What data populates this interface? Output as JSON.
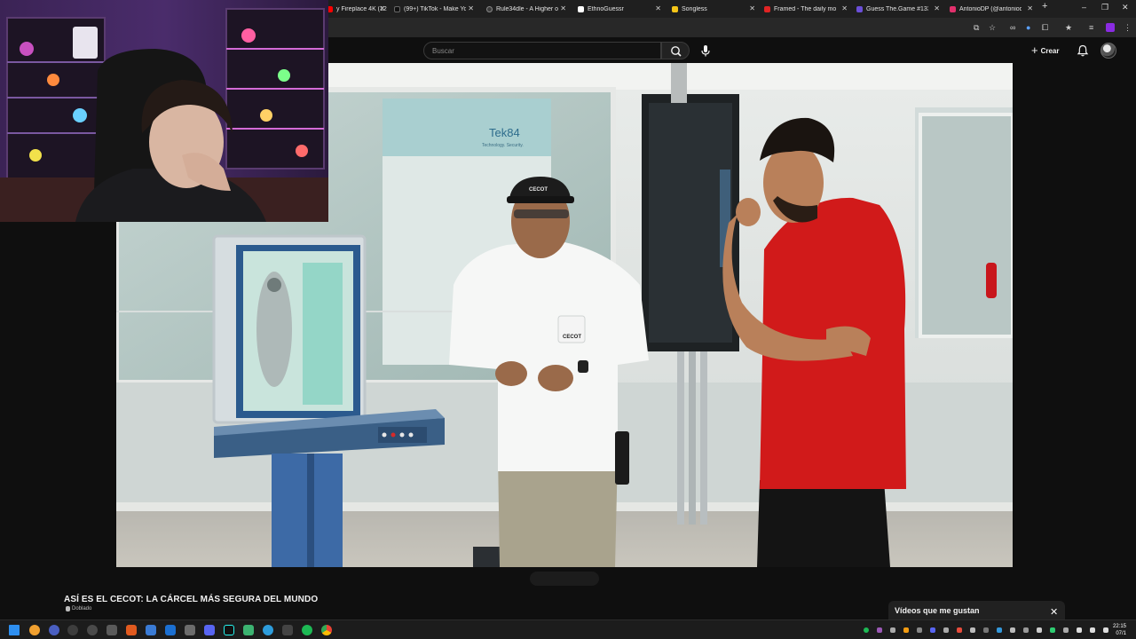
{
  "browser": {
    "tabs": [
      {
        "label": "y Fireplace 4K (12",
        "favicon_color": "#ff0000"
      },
      {
        "label": "(99+) TikTok - Make Your",
        "favicon_color": "#111111"
      },
      {
        "label": "Rule34dle - A Higher or L",
        "favicon_color": "#3c3c3c"
      },
      {
        "label": "EthnoGuessr",
        "favicon_color": "#ffffff"
      },
      {
        "label": "Songless",
        "favicon_color": "#f5c518"
      },
      {
        "label": "Framed - The daily movie",
        "favicon_color": "#e02424"
      },
      {
        "label": "Guess The.Game #1334",
        "favicon_color": "#6b4fd8"
      },
      {
        "label": "AntonioDP (@antoniodie",
        "favicon_color": "#e1306c"
      }
    ],
    "new_tab": "+",
    "window_controls": {
      "minimize": "–",
      "maximize": "❐",
      "close": "✕"
    }
  },
  "youtube": {
    "search": {
      "placeholder": "Buscar"
    },
    "create_label": "Crear",
    "icons": {
      "search": "search-icon",
      "mic": "mic-icon",
      "bell": "bell-icon"
    },
    "video_title": "ASÍ ES EL CECOT: LA CÁRCEL MÁS SEGURA DEL MUNDO",
    "dub_badge": "Doblado",
    "liked_panel": {
      "title": "Vídeos que me gustan",
      "close": "✕"
    }
  },
  "video_scene": {
    "screen_brand": "Tek84",
    "screen_sub": "Technology. Security.",
    "cap_logo": "CECOT",
    "shirt_logo": "CECOT"
  },
  "taskbar": {
    "clock_time": "22:15",
    "clock_date": "07/1"
  },
  "colors": {
    "yt_bg": "#0f0f0f",
    "tabstrip_bg": "#1f1f1f",
    "red_shirt": "#d11a1a",
    "kiosk_blue": "#3d6aa6"
  }
}
